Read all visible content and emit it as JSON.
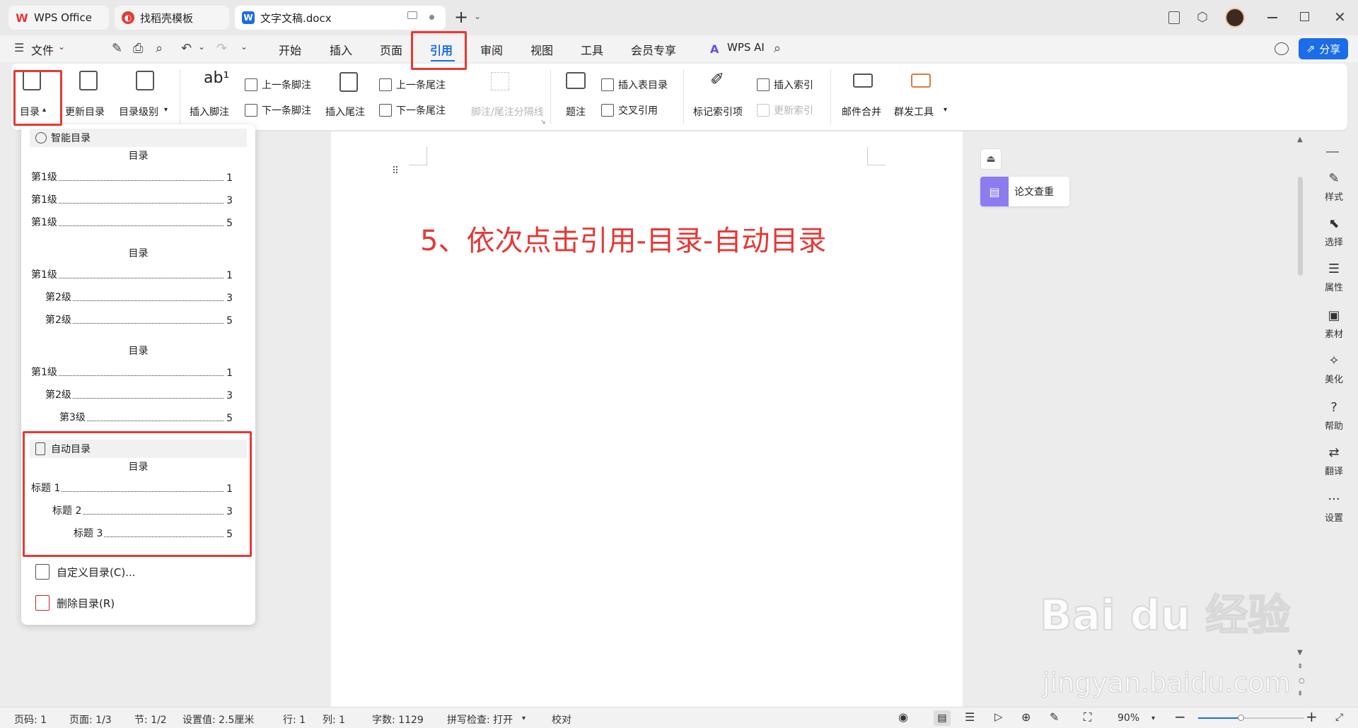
{
  "tabs": [
    {
      "label": "WPS Office"
    },
    {
      "label": "找稻壳模板"
    },
    {
      "label": "文字文稿.docx"
    }
  ],
  "menu": {
    "file": "文件",
    "items": [
      "开始",
      "插入",
      "页面",
      "引用",
      "审阅",
      "视图",
      "工具",
      "会员专享"
    ],
    "active": "引用",
    "wps_ai": "WPS AI",
    "share": "分享"
  },
  "ribbon": {
    "toc": "目录",
    "update_toc": "更新目录",
    "toc_level": "目录级别",
    "insert_footnote": "插入脚注",
    "prev_footnote": "上一条脚注",
    "next_footnote": "下一条脚注",
    "insert_endnote": "插入尾注",
    "prev_endnote": "上一条尾注",
    "next_endnote": "下一条尾注",
    "separator": "脚注/尾注分隔线",
    "caption": "题注",
    "insert_table_of_figures": "插入表目录",
    "cross_reference": "交叉引用",
    "mark_index": "标记索引项",
    "insert_index": "插入索引",
    "update_index": "更新索引",
    "mail_merge": "邮件合并",
    "mass_tools": "群发工具"
  },
  "dropdown": {
    "smart_section": "智能目录",
    "auto_section": "自动目录",
    "toc_title": "目录",
    "blocks": [
      [
        {
          "text": "第1级",
          "page": "1",
          "level": 0
        },
        {
          "text": "第1级",
          "page": "3",
          "level": 0
        },
        {
          "text": "第1级",
          "page": "5",
          "level": 0
        }
      ],
      [
        {
          "text": "第1级",
          "page": "1",
          "level": 0
        },
        {
          "text": "第2级",
          "page": "3",
          "level": 1
        },
        {
          "text": "第2级",
          "page": "5",
          "level": 1
        }
      ],
      [
        {
          "text": "第1级",
          "page": "1",
          "level": 0
        },
        {
          "text": "第2级",
          "page": "3",
          "level": 1
        },
        {
          "text": "第3级",
          "page": "5",
          "level": 2
        }
      ]
    ],
    "auto_entries": [
      {
        "text": "标题 1",
        "page": "1",
        "level": 0
      },
      {
        "text": "标题 2",
        "page": "3",
        "level": 1
      },
      {
        "text": "标题 3",
        "page": "5",
        "level": 2
      }
    ],
    "custom_toc": "自定义目录(C)...",
    "delete_toc": "删除目录(R)"
  },
  "document": {
    "text": "5、依次点击引用-目录-自动目录",
    "text_color": "#e53935"
  },
  "side_panel": {
    "paper_check": "论文查重"
  },
  "sidebar": [
    "样式",
    "选择",
    "属性",
    "素材",
    "美化",
    "帮助",
    "翻译",
    "设置"
  ],
  "status": {
    "page": "页码: 1",
    "pages": "页面: 1/3",
    "section": "节: 1/2",
    "setting": "设置值: 2.5厘米",
    "row": "行: 1",
    "col": "列: 1",
    "words": "字数: 1129",
    "spell": "拼写检查: 打开",
    "proof": "校对",
    "zoom": "90%"
  },
  "watermark": {
    "brand": "Bai du 经验",
    "url": "jingyan.baidu.com"
  },
  "colors": {
    "accent": "#1a6ce8",
    "highlight": "#e53935"
  }
}
